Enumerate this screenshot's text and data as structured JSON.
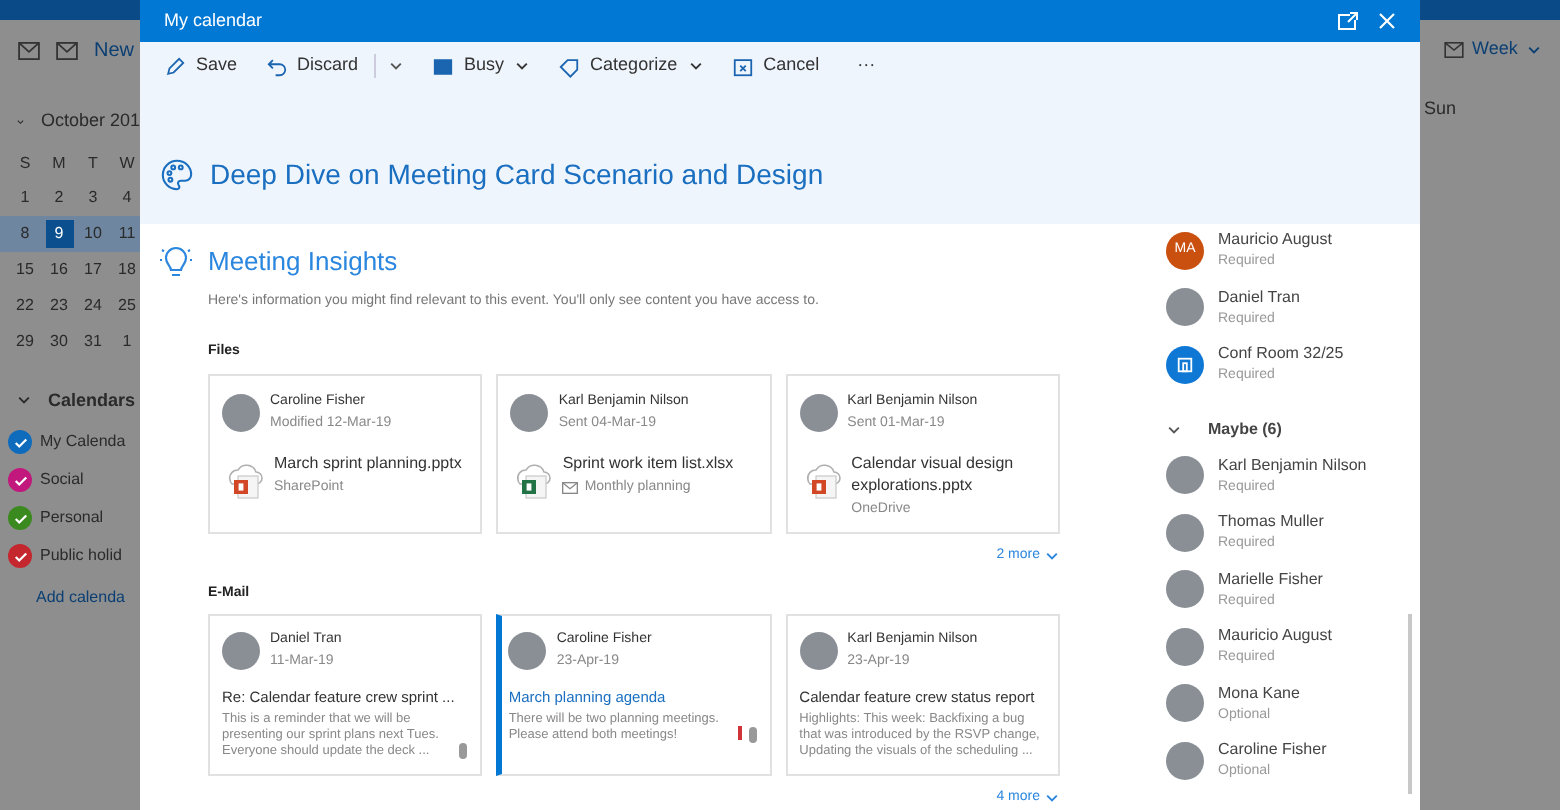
{
  "background": {
    "new_label": "New",
    "mini_calendar": {
      "month": "October 201",
      "weekdays": [
        "S",
        "M",
        "T",
        "W"
      ],
      "weeks": [
        {
          "selected": false,
          "days": [
            {
              "day": "1",
              "selected": false
            },
            {
              "day": "2",
              "selected": false
            },
            {
              "day": "3",
              "selected": false
            },
            {
              "day": "4",
              "selected": false
            }
          ]
        },
        {
          "selected": true,
          "days": [
            {
              "day": "8",
              "selected": false
            },
            {
              "day": "9",
              "selected": true
            },
            {
              "day": "10",
              "selected": false
            },
            {
              "day": "11",
              "selected": false
            }
          ]
        },
        {
          "selected": false,
          "days": [
            {
              "day": "15",
              "selected": false
            },
            {
              "day": "16",
              "selected": false
            },
            {
              "day": "17",
              "selected": false
            },
            {
              "day": "18",
              "selected": false
            }
          ]
        },
        {
          "selected": false,
          "days": [
            {
              "day": "22",
              "selected": false
            },
            {
              "day": "23",
              "selected": false
            },
            {
              "day": "24",
              "selected": false
            },
            {
              "day": "25",
              "selected": false
            }
          ]
        },
        {
          "selected": false,
          "days": [
            {
              "day": "29",
              "selected": false
            },
            {
              "day": "30",
              "selected": false
            },
            {
              "day": "31",
              "selected": false
            },
            {
              "day": "1",
              "selected": false
            }
          ]
        }
      ]
    },
    "calendars": {
      "heading": "Calendars",
      "items": [
        {
          "label": "My Calenda",
          "color": "#0f6cbd",
          "checked": true
        },
        {
          "label": "Social",
          "color": "#c2187d",
          "checked": true
        },
        {
          "label": "Personal",
          "color": "#3a8a1f",
          "checked": true
        },
        {
          "label": "Public holid",
          "color": "#c4282e",
          "checked": true
        }
      ],
      "add_link": "Add calenda"
    },
    "view": "Week",
    "day": "Sun"
  },
  "window": {
    "title": "My calendar"
  },
  "toolbar": [
    {
      "kind": "save",
      "label": "Save",
      "dropdown": false
    },
    {
      "kind": "discard",
      "label": "Discard",
      "dropdown": true
    },
    {
      "kind": "busy",
      "label": "Busy",
      "dropdown": true
    },
    {
      "kind": "categorize",
      "label": "Categorize",
      "dropdown": true
    },
    {
      "kind": "cancel",
      "label": "Cancel",
      "dropdown": false
    },
    {
      "kind": "more",
      "label": "···",
      "dropdown": false
    }
  ],
  "event": {
    "title": "Deep Dive on Meeting Card Scenario and Design"
  },
  "insights": {
    "title": "Meeting Insights",
    "description": "Here's information you might find relevant to this event. You'll only see content you have access to.",
    "files": {
      "label": "Files",
      "more": "2 more",
      "cards": [
        {
          "author": "Caroline Fisher",
          "meta": "Modified 12-Mar-19",
          "file_name": "March sprint planning.pptx",
          "kind": "pptx",
          "location": {
            "kind": "site",
            "label": "SharePoint"
          }
        },
        {
          "author": "Karl Benjamin Nilson",
          "meta": "Sent 04-Mar-19",
          "file_name": "Sprint work item list.xlsx",
          "kind": "xlsx",
          "location": {
            "kind": "mail",
            "label": "Monthly planning"
          }
        },
        {
          "author": "Karl Benjamin Nilson",
          "meta": "Sent 01-Mar-19",
          "file_name": "Calendar visual design explorations.pptx",
          "kind": "pptx",
          "location": {
            "kind": "site",
            "label": "OneDrive"
          }
        }
      ]
    },
    "email": {
      "label": "E-Mail",
      "more": "4 more",
      "cards": [
        {
          "author": "Daniel Tran",
          "date": "11-Mar-19",
          "subject": "Re: Calendar feature crew sprint ...",
          "preview": "This is a reminder that we will be presenting our sprint plans next Tues. Everyone should update the deck ...",
          "selected": false,
          "important": false,
          "attachment": true
        },
        {
          "author": "Caroline Fisher",
          "date": "23-Apr-19",
          "subject": "March planning agenda",
          "preview": "There will be two planning meetings. Please attend both meetings!",
          "selected": true,
          "important": true,
          "attachment": true
        },
        {
          "author": "Karl Benjamin Nilson",
          "date": "23-Apr-19",
          "subject": "Calendar feature crew status report",
          "preview": "Highlights:  This week:  Backfixing a bug that was introduced by the RSVP change, Updating the visuals of the scheduling ...",
          "selected": false,
          "important": false,
          "attachment": false
        }
      ]
    }
  },
  "attendees": {
    "items": [
      {
        "kind": "initials",
        "initials": "MA",
        "name": "Mauricio August",
        "role": "Required"
      },
      {
        "kind": "photo",
        "name": "Daniel Tran",
        "role": "Required"
      },
      {
        "kind": "room",
        "name": "Conf Room 32/25",
        "role": "Required"
      }
    ],
    "groups": [
      {
        "label": "Maybe (6)",
        "expanded": true,
        "items": [
          {
            "kind": "photo",
            "name": "Karl Benjamin Nilson",
            "role": "Required"
          },
          {
            "kind": "photo",
            "name": "Thomas Muller",
            "role": "Required"
          },
          {
            "kind": "photo",
            "name": "Marielle Fisher",
            "role": "Required"
          },
          {
            "kind": "photo",
            "name": "Mauricio August",
            "role": "Required"
          },
          {
            "kind": "photo",
            "name": "Mona Kane",
            "role": "Optional"
          },
          {
            "kind": "photo",
            "name": "Caroline Fisher",
            "role": "Optional"
          }
        ]
      }
    ]
  }
}
